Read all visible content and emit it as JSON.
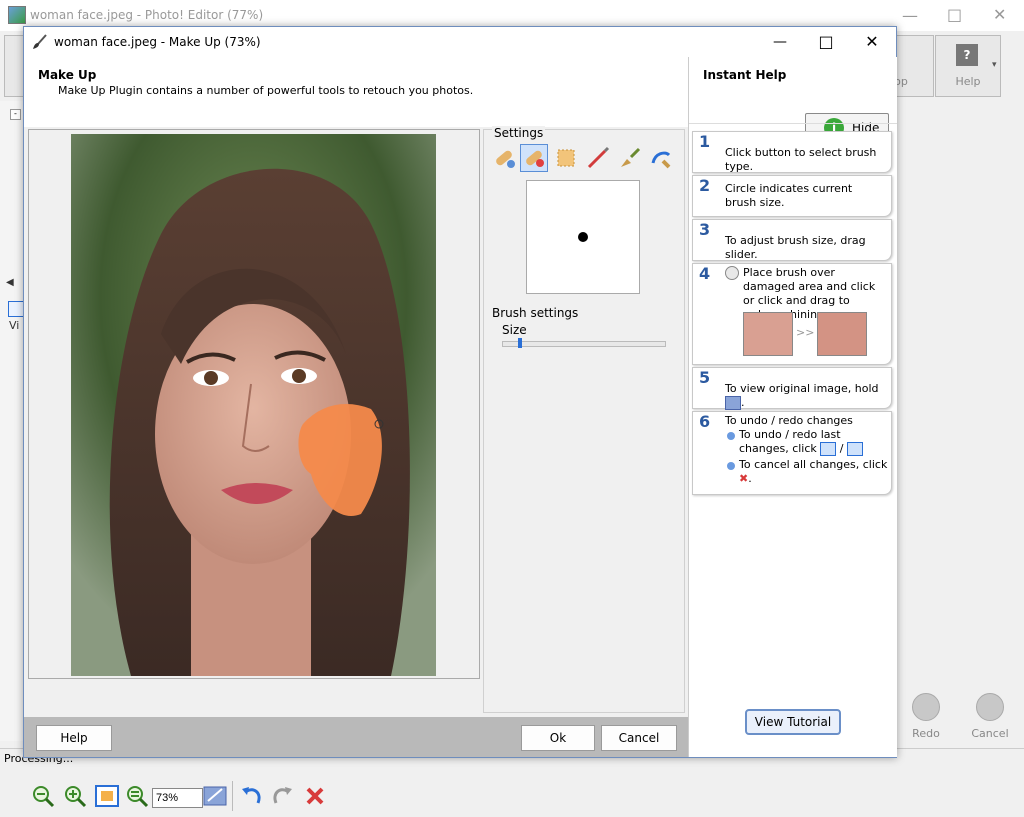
{
  "background_app": {
    "title": "woman face.jpeg - Photo! Editor (77%)",
    "toolbar_right": [
      {
        "label": "op"
      },
      {
        "label": "Help"
      }
    ],
    "bottom_buttons": [
      {
        "label": "Redo"
      },
      {
        "label": "Cancel"
      }
    ],
    "status_text": "Processing...",
    "left_panel_fragment": "Vi"
  },
  "dialog": {
    "title": "woman face.jpeg - Make Up (73%)",
    "header": {
      "title": "Make Up",
      "subtitle": "Make Up Plugin contains a number of powerful tools to retouch you photos."
    },
    "settings": {
      "title": "Settings",
      "brush_types": [
        "brush-type-1",
        "brush-type-2",
        "brush-type-3",
        "brush-type-4",
        "brush-type-5",
        "brush-type-6"
      ],
      "selected_brush": 1,
      "brush_settings_label": "Brush settings",
      "size_label": "Size",
      "size_value": 0.1
    },
    "zoom_value": "73%",
    "footer": {
      "help": "Help",
      "ok": "Ok",
      "cancel": "Cancel"
    }
  },
  "instant_help": {
    "title": "Instant Help",
    "hide_label": "Hide",
    "steps": [
      {
        "num": "1",
        "text": "Click button to select brush type."
      },
      {
        "num": "2",
        "text": "Circle indicates current brush size."
      },
      {
        "num": "3",
        "text": "To adjust brush size, drag slider."
      },
      {
        "num": "4",
        "text": "Place brush over damaged area and click or click and drag to reduce shining."
      },
      {
        "num": "5",
        "text": "To view original image, hold",
        "text_after": "."
      },
      {
        "num": "6",
        "text": "To undo / redo changes",
        "bullet1": "To undo / redo last changes, click",
        "bullet1_sep": "/",
        "bullet2": "To cancel all changes, click",
        "bullet_end": "."
      }
    ],
    "before_after_sep": ">>",
    "tutorial_label": "View Tutorial"
  },
  "colors": {
    "accent": "#2c5aa0",
    "paint": "#f48a4b"
  }
}
